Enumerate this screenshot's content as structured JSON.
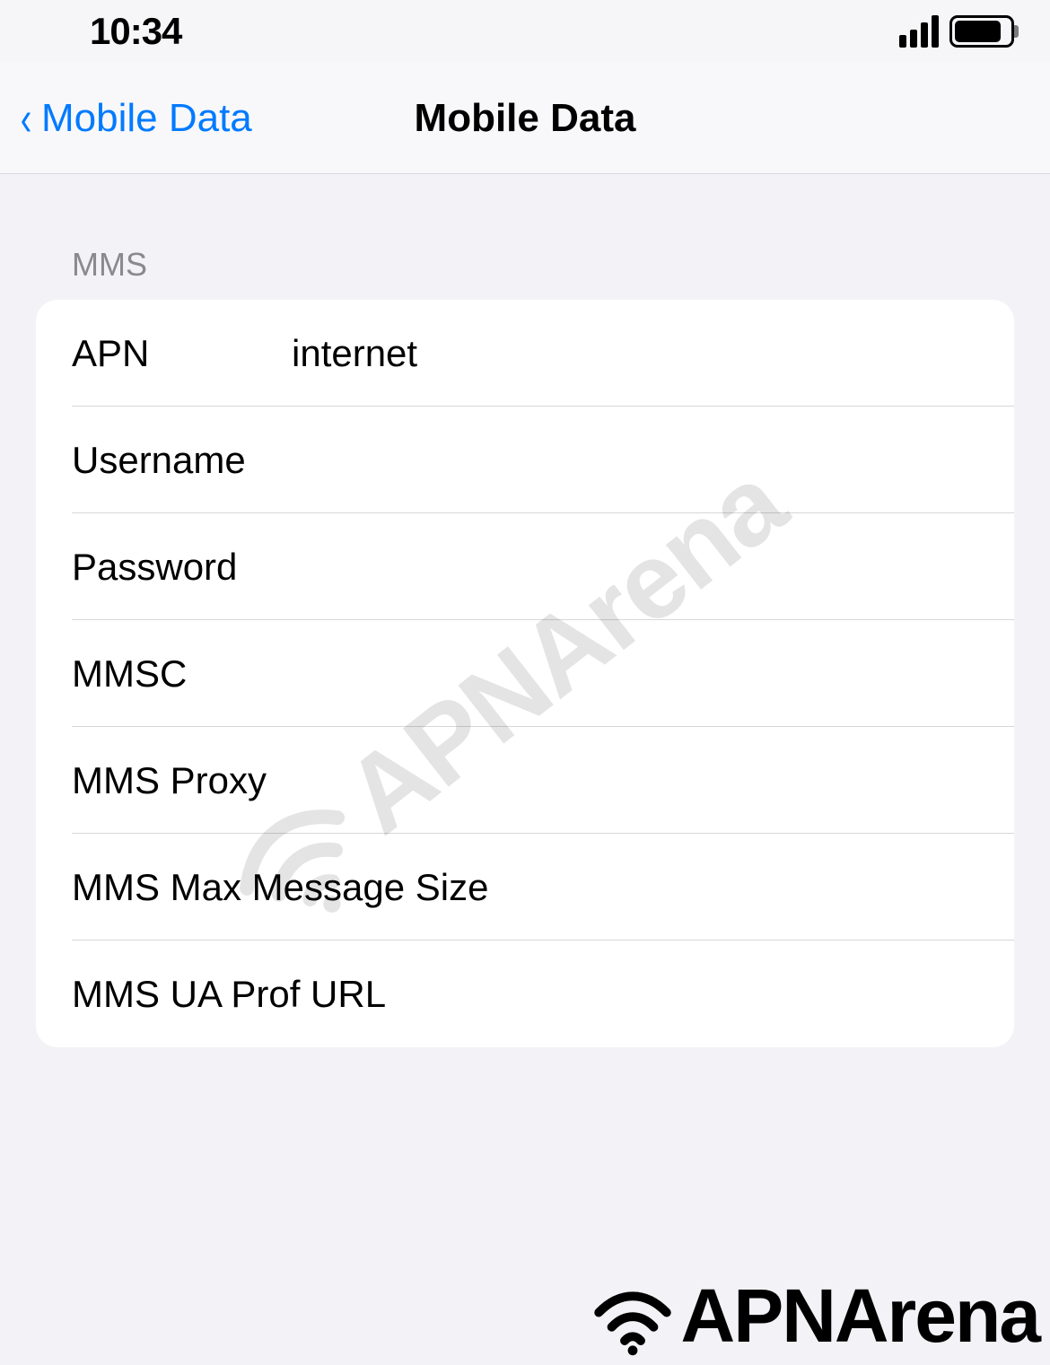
{
  "status": {
    "time": "10:34"
  },
  "nav": {
    "back_label": "Mobile Data",
    "title": "Mobile Data"
  },
  "section": {
    "header": "MMS"
  },
  "fields": {
    "apn": {
      "label": "APN",
      "value": "internet"
    },
    "username": {
      "label": "Username",
      "value": ""
    },
    "password": {
      "label": "Password",
      "value": ""
    },
    "mmsc": {
      "label": "MMSC",
      "value": ""
    },
    "proxy": {
      "label": "MMS Proxy",
      "value": ""
    },
    "maxsize": {
      "label": "MMS Max Message Size",
      "value": ""
    },
    "uaprof": {
      "label": "MMS UA Prof URL",
      "value": ""
    }
  },
  "watermark": {
    "text": "APNArena"
  },
  "brand": {
    "text": "APNArena"
  }
}
